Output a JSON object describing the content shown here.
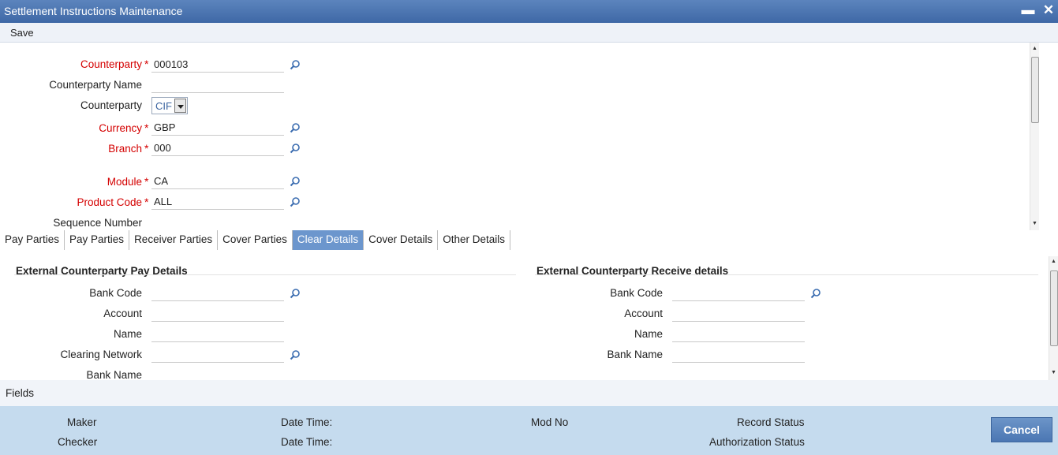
{
  "window": {
    "title": "Settlement Instructions Maintenance",
    "minimize_glyph": "▬",
    "close_glyph": "✕"
  },
  "toolbar": {
    "save_label": "Save"
  },
  "header_form": {
    "counterparty": {
      "label": "Counterparty",
      "value": "000103"
    },
    "counterparty_name": {
      "label": "Counterparty Name",
      "value": ""
    },
    "counterparty_type": {
      "label": "Counterparty",
      "value": "CIF"
    },
    "currency": {
      "label": "Currency",
      "value": "GBP"
    },
    "branch": {
      "label": "Branch",
      "value": "000"
    },
    "module": {
      "label": "Module",
      "value": "CA"
    },
    "product_code": {
      "label": "Product Code",
      "value": "ALL"
    },
    "sequence_number": {
      "label": "Sequence Number",
      "value": ""
    },
    "required_marker": "*"
  },
  "tabs": [
    {
      "label": "Pay Parties",
      "active": false
    },
    {
      "label": "Pay Parties",
      "active": false
    },
    {
      "label": "Receiver Parties",
      "active": false
    },
    {
      "label": "Cover Parties",
      "active": false
    },
    {
      "label": "Clear Details",
      "active": true
    },
    {
      "label": "Cover Details",
      "active": false
    },
    {
      "label": "Other Details",
      "active": false
    }
  ],
  "pay_details": {
    "title": "External Counterparty Pay Details",
    "bank_code": {
      "label": "Bank Code",
      "value": ""
    },
    "account": {
      "label": "Account",
      "value": ""
    },
    "name": {
      "label": "Name",
      "value": ""
    },
    "clearing_network": {
      "label": "Clearing Network",
      "value": ""
    },
    "bank_name": {
      "label": "Bank Name",
      "value": ""
    }
  },
  "receive_details": {
    "title": "External Counterparty Receive details",
    "bank_code": {
      "label": "Bank Code",
      "value": ""
    },
    "account": {
      "label": "Account",
      "value": ""
    },
    "name": {
      "label": "Name",
      "value": ""
    },
    "bank_name": {
      "label": "Bank Name",
      "value": ""
    }
  },
  "fields_bar": {
    "label": "Fields"
  },
  "footer": {
    "maker_label": "Maker",
    "checker_label": "Checker",
    "maker_datetime_label": "Date Time:",
    "checker_datetime_label": "Date Time:",
    "mod_no_label": "Mod No",
    "record_status_label": "Record Status",
    "authorization_status_label": "Authorization Status",
    "cancel_label": "Cancel"
  },
  "colors": {
    "title_bar": "#4a73ae",
    "active_tab": "#6c96cd",
    "required": "#d40000",
    "footer": "#c5dbee",
    "button": "#5a84be"
  },
  "icons": {
    "lov": "search-icon",
    "dropdown": "chevron-down-icon"
  }
}
